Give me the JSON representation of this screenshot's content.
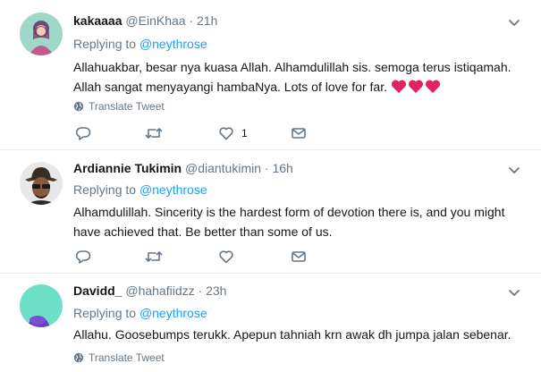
{
  "tweets": [
    {
      "name": "kakaaaa",
      "handle": "@EinKhaa",
      "separator": "·",
      "time": "21h",
      "replying_prefix": "Replying to",
      "replying_to": "@neythrose",
      "text": "Allahuakbar, besar nya kuasa Allah. Alhamdulillah sis. semoga terus istiqamah. Allah sangat menyayangi hambaNya. Lots of love for far.",
      "emoji": [
        "red-heart",
        "red-heart",
        "red-heart"
      ],
      "translate_label": "Translate Tweet",
      "like_count": "1"
    },
    {
      "name": "Ardiannie Tukimin",
      "handle": "@diantukimin",
      "separator": "·",
      "time": "16h",
      "replying_prefix": "Replying to",
      "replying_to": "@neythrose",
      "text": "Alhamdulillah. Sincerity is the hardest form of devotion there is, and you might have achieved that. Be better than some of us.",
      "like_count": ""
    },
    {
      "name": "Davidd_",
      "handle": "@hahafiidzz",
      "separator": "·",
      "time": "23h",
      "replying_prefix": "Replying to",
      "replying_to": "@neythrose",
      "text": "Allahu. Goosebumps terukk. Apepun tahniah krn awak dh jumpa jalan sebenar.",
      "translate_label": "Translate Tweet"
    }
  ],
  "colors": {
    "accent": "#1da1f2",
    "muted": "#657786",
    "heart": "#e0245e",
    "divider": "#e6ecf0"
  },
  "icons": [
    "reply-icon",
    "retweet-icon",
    "like-icon",
    "dm-icon",
    "globe-icon",
    "chevron-down-icon"
  ]
}
